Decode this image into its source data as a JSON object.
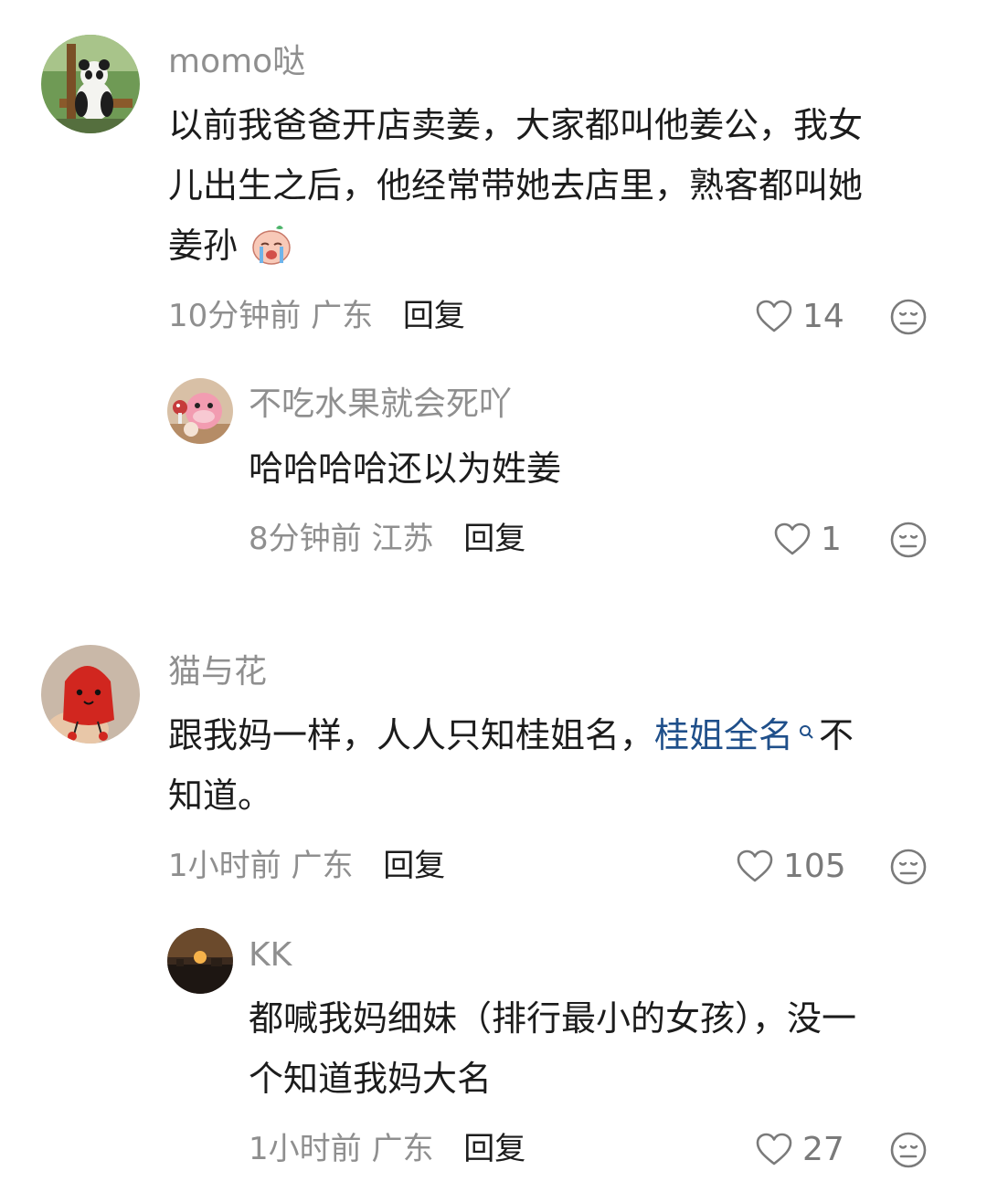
{
  "comments": [
    {
      "username": "momo哒",
      "text_lines": [
        "以前我爸爸开店卖姜，大家都叫他姜公，我女",
        "儿出生之后，他经常带她去店里，熟客都叫她",
        "姜孙"
      ],
      "emoji": "crying-face-emoji",
      "time": "10分钟前",
      "location": "广东",
      "reply_label": "回复",
      "likes": "14",
      "replies": [
        {
          "username": "不吃水果就会死吖",
          "text_lines": [
            "哈哈哈哈还以为姓姜"
          ],
          "time": "8分钟前",
          "location": "江苏",
          "reply_label": "回复",
          "likes": "1"
        }
      ]
    },
    {
      "username": "猫与花",
      "text_before_link": "跟我妈一样，人人只知桂姐名，",
      "link_text": "桂姐全名",
      "text_after_link": "不",
      "text_line2": "知道。",
      "time": "1小时前",
      "location": "广东",
      "reply_label": "回复",
      "likes": "105",
      "replies": [
        {
          "username": "KK",
          "text_lines": [
            "都喊我妈细妹（排行最小的女孩），没一",
            "个知道我妈大名"
          ],
          "time": "1小时前",
          "location": "广东",
          "reply_label": "回复",
          "likes": "27"
        }
      ]
    }
  ],
  "icons": {
    "like": "heart-outline-icon",
    "dislike": "meh-face-icon",
    "search": "search-icon"
  },
  "colors": {
    "link": "#1f4f8a",
    "meta": "#8f8f8f",
    "text": "#1c1c1c"
  }
}
